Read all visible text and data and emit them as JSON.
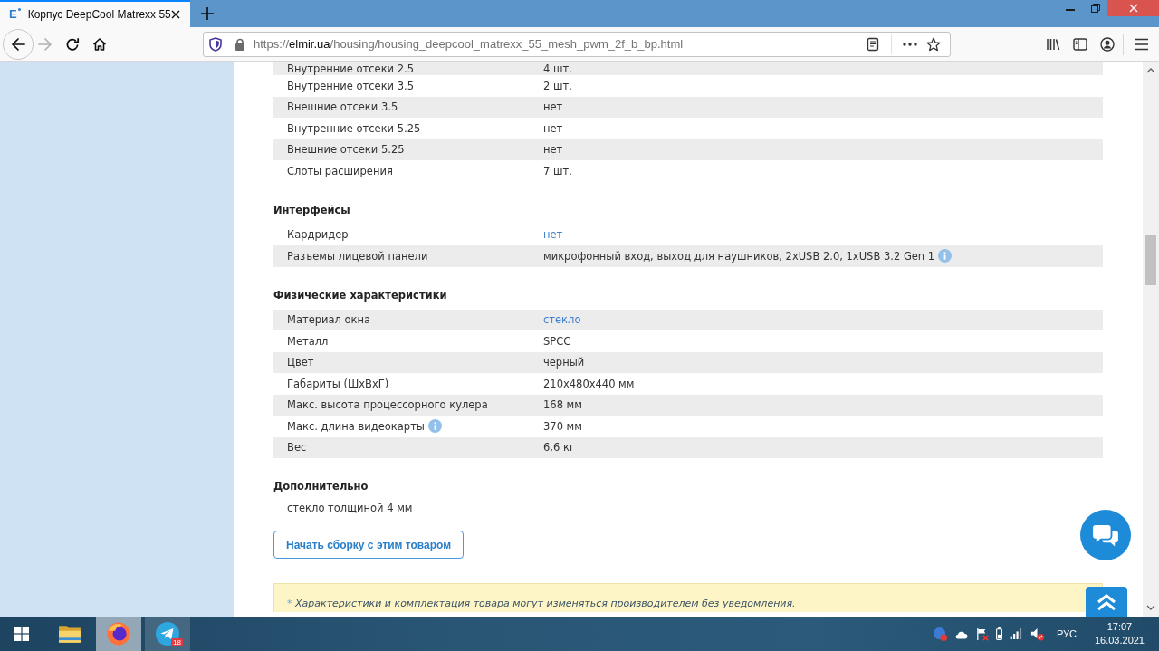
{
  "browser": {
    "tabs": [
      {
        "title": "Корпус DeepCool Matrexx 55",
        "icon_letter": "E",
        "selected": true
      }
    ],
    "back_disabled": false,
    "forward_disabled": true,
    "url": {
      "scheme": "https://",
      "host": "elmir.ua",
      "path": "/housing/housing_deepcool_matrexx_55_mesh_pwm_2f_b_bp.html"
    }
  },
  "sections": [
    {
      "rows": [
        {
          "label": "Внутренние отсеки 2.5",
          "value": "4 шт.",
          "shaded": true,
          "link": false
        },
        {
          "label": "Внутренние отсеки 3.5",
          "value": "2 шт.",
          "shaded": false,
          "link": false
        },
        {
          "label": "Внешние отсеки 3.5",
          "value": "нет",
          "shaded": true,
          "link": false
        },
        {
          "label": "Внутренние отсеки 5.25",
          "value": "нет",
          "shaded": false,
          "link": false
        },
        {
          "label": "Внешние отсеки 5.25",
          "value": "нет",
          "shaded": true,
          "link": false
        },
        {
          "label": "Слоты расширения",
          "value": "7 шт.",
          "shaded": false,
          "link": false
        }
      ]
    },
    {
      "title": "Интерфейсы",
      "rows": [
        {
          "label": "Кардридер",
          "value": "нет",
          "shaded": false,
          "link": true
        },
        {
          "label": "Разъемы лицевой панели",
          "value": "микрофонный вход, выход для наушников, 2xUSB 2.0, 1xUSB 3.2 Gen 1",
          "shaded": true,
          "link": false,
          "value_info": true
        }
      ]
    },
    {
      "title": "Физические характеристики",
      "rows": [
        {
          "label": "Материал окна",
          "value": "стекло",
          "shaded": true,
          "link": true
        },
        {
          "label": "Металл",
          "value": "SPCC",
          "shaded": false,
          "link": false
        },
        {
          "label": "Цвет",
          "value": "черный",
          "shaded": true,
          "link": false
        },
        {
          "label": "Габариты (ШхВхГ)",
          "value": "210x480x440 мм",
          "shaded": false,
          "link": false
        },
        {
          "label": "Макс. высота процессорного кулера",
          "value": "168 мм",
          "shaded": true,
          "link": false
        },
        {
          "label": "Макс. длина видеокарты",
          "value": "370 мм",
          "shaded": false,
          "link": false,
          "label_info": true
        },
        {
          "label": "Вес",
          "value": "6,6 кг",
          "shaded": true,
          "link": false
        }
      ]
    }
  ],
  "additional": {
    "title": "Дополнительно",
    "text": "стекло толщиной 4 мм"
  },
  "build_button": "Начать сборку с этим товаром",
  "notice": {
    "mark": "*",
    "text": "Характеристики и комплектация товара могут изменяться производителем без уведомления."
  },
  "taskbar": {
    "apps": [
      {
        "kind": "explorer",
        "open": false,
        "selected": false
      },
      {
        "kind": "browser",
        "open": true,
        "selected": true
      },
      {
        "kind": "messenger",
        "open": true,
        "selected": false,
        "badge": "18"
      }
    ],
    "language": "РУС",
    "time": "17:07",
    "date": "16.03.2021"
  }
}
